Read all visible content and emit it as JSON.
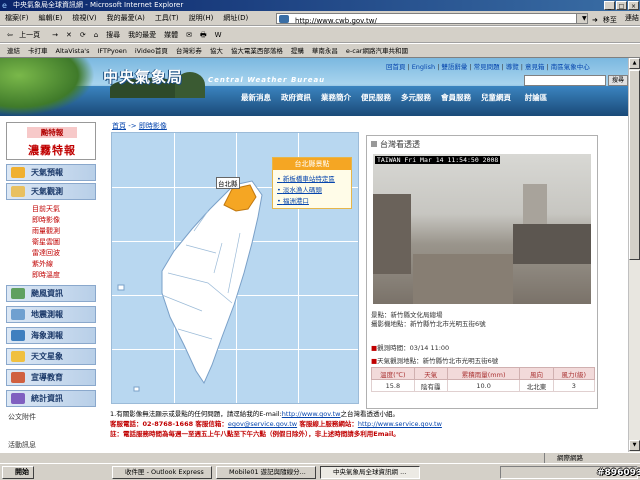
{
  "window": {
    "title": "中央氣象局全球資訊網 - Microsoft Internet Explorer"
  },
  "menubar": {
    "items": [
      "檔案(F)",
      "編輯(E)",
      "檢視(V)",
      "我的最愛(A)",
      "工具(T)",
      "說明(H)"
    ],
    "address_label": "網址(D)",
    "address": "http://www.cwb.gov.tw/",
    "go": "移至",
    "links": "連結"
  },
  "toolbar": {
    "items": [
      "上一頁",
      "→",
      "✕",
      "⟳",
      "⌂",
      "搜尋",
      "我的最愛",
      "媒體",
      "✉",
      "🖶",
      "W"
    ]
  },
  "linksbar": {
    "items": [
      "連結",
      "卡打車",
      "AltaVista's",
      "IFTPyoen",
      "iVideo首頁",
      "台灣彩券",
      "協大",
      "協大電業西部落格",
      "提購",
      "華南永昌",
      "e-car網路汽車共和國"
    ]
  },
  "header": {
    "logo": "中央氣象局",
    "logo_en": "Central Weather Bureau",
    "toplinks": [
      "回首頁",
      "English",
      "雙語辭彙",
      "常見問題",
      "導覽",
      "意見箱",
      "南區氣象中心"
    ],
    "search_btn": "搜尋",
    "nav": [
      "最新消息",
      "政府資訊",
      "業務簡介",
      "便民服務",
      "多元服務",
      "會員服務",
      "兒童網頁",
      "討論區"
    ]
  },
  "sidebar": {
    "typhoon_label": "颱特報",
    "fog_label": "濃霧特報",
    "menu": [
      "天氣預報",
      "天氣觀測",
      "颱風資訊",
      "地震測報",
      "海象測報",
      "天文星象",
      "宣導教育",
      "統計資訊"
    ],
    "sub": [
      "目前天氣",
      "即時影像",
      "雨量觀測",
      "衛星雲圖",
      "雷達回波",
      "紫外線",
      "即時溫度"
    ],
    "more": [
      "公文附件",
      "活動訊息"
    ]
  },
  "breadcrumb": {
    "home": "首頁",
    "sep": " -> ",
    "current": "即時影像"
  },
  "map": {
    "selected": "台北縣",
    "popup_title": "台北縣景點",
    "popup_links": [
      "新板橋車站特定區",
      "淡水漁人碼頭",
      "福洲港口"
    ]
  },
  "camera": {
    "heading": "台灣看透透",
    "timestamp": "TAIWAN  Fri Mar 14  11:54:50  2008",
    "caption_place": "景點：新竹縣文化局總場",
    "caption_loc": "攝影機地點：新竹縣竹北市光明五街6號",
    "obs_time": "觀測時間：03/14 11:00",
    "obs_station": "天氣觀測地點：新竹縣竹北市光明五街6號",
    "table_headers": [
      "溫度(℃)",
      "天氣",
      "累積雨量(mm)",
      "風向",
      "風力(級)"
    ],
    "table_values": [
      "15.8",
      "陰有霾",
      "10.0",
      "北北東",
      "3"
    ]
  },
  "notes": {
    "line1": "1.有關影像無法顯示或景點的任何問題，請逕給我的E-mail:",
    "line1_link": "http://www.gov.tw",
    "line1_tail": "之台灣看透透小組。",
    "line2_a": "客服電話：02-8768-1668  客服信箱：",
    "line2_email": "egov@service.gov.tw",
    "line2_b": "  客服線上服務網站：",
    "line2_link": "http://www.service.gov.tw",
    "line3": "註：電話服務時間為每週一至週五上午八點至下午六點（例假日除外），非上述時間請多利用Email。"
  },
  "status": {
    "left": "",
    "zone": "網際網路"
  },
  "taskbar": {
    "start": "開始",
    "tasks": [
      "收件匣 - Outlook Express",
      "Mobile01 遊記與隨線分...",
      "中央氣象局全球資訊網 ..."
    ],
    "clock": "#896093"
  },
  "colors": {
    "titlebar": "#0a246a",
    "accent_red": "#c00000",
    "link": "#0645ad",
    "map_sea": "#b8d7f0"
  }
}
